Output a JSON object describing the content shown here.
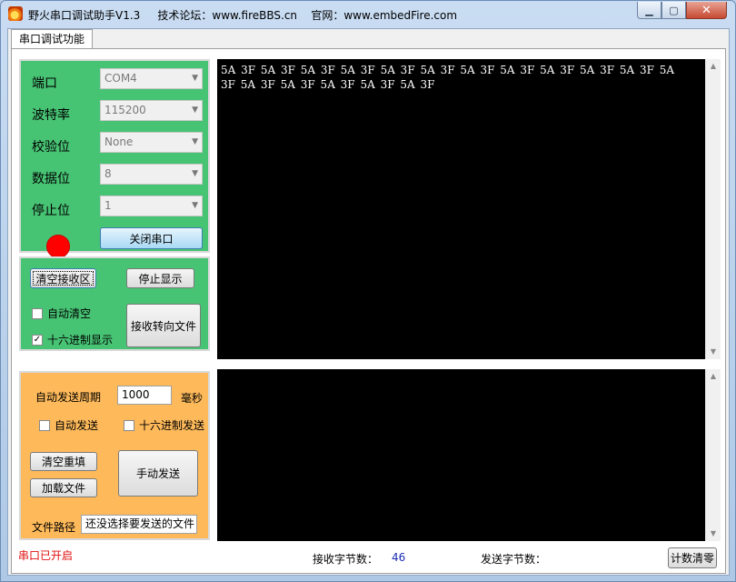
{
  "window": {
    "title": "野火串口调试助手V1.3",
    "forum": "技术论坛：www.fireBBS.cn",
    "site": "官网：www.embedFire.com"
  },
  "tab": {
    "label": "串口调试功能"
  },
  "serial": {
    "port_label": "端口",
    "port_value": "COM4",
    "baud_label": "波特率",
    "baud_value": "115200",
    "parity_label": "校验位",
    "parity_value": "None",
    "databits_label": "数据位",
    "databits_value": "8",
    "stopbits_label": "停止位",
    "stopbits_value": "1",
    "status_color": "#ff0000",
    "toggle_label": "关闭串口"
  },
  "receive": {
    "clear_label": "清空接收区",
    "stop_label": "停止显示",
    "auto_clear_label": "自动清空",
    "auto_clear_checked": false,
    "hex_display_label": "十六进制显示",
    "hex_display_checked": true,
    "to_file_label": "接收转向文件",
    "text": "5A 3F 5A 3F 5A 3F 5A 3F 5A 3F 5A 3F 5A 3F 5A 3F 5A 3F 5A 3F 5A 3F 5A 3F 5A 3F 5A 3F 5A 3F 5A 3F 5A 3F"
  },
  "send": {
    "period_label": "自动发送周期",
    "period_value": "1000",
    "period_unit": "毫秒",
    "auto_send_label": "自动发送",
    "hex_send_label": "十六进制发送",
    "clear_refill_label": "清空重填",
    "load_file_label": "加载文件",
    "manual_send_label": "手动发送",
    "file_path_label": "文件路径",
    "file_path_value": "还没选择要发送的文件"
  },
  "status": {
    "port_state": "串口已开启",
    "rx_label": "接收字节数：",
    "rx_value": "46",
    "tx_label": "发送字节数：",
    "tx_value": "",
    "reset_label": "计数清零"
  }
}
